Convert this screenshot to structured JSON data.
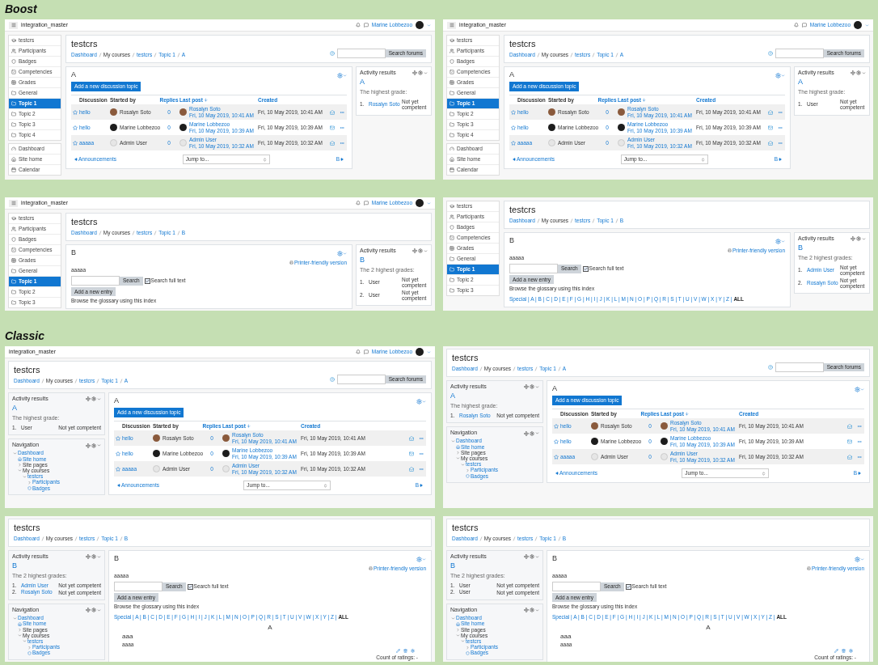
{
  "sections": [
    {
      "label": "Boost",
      "panels": [
        {
          "kind": "boost",
          "navbar": {
            "menu_button": true,
            "site": "integration_master",
            "user": "Marine Lobbezoo"
          },
          "sidebar": {
            "groups": [
              {
                "items": [
                  {
                    "kind": "course",
                    "label": "testcrs",
                    "selected": false
                  },
                  {
                    "kind": "people",
                    "label": "Participants",
                    "selected": false
                  },
                  {
                    "kind": "badges",
                    "label": "Badges",
                    "selected": false
                  },
                  {
                    "kind": "competencies",
                    "label": "Competencies",
                    "selected": false
                  },
                  {
                    "kind": "grades",
                    "label": "Grades",
                    "selected": false
                  },
                  {
                    "kind": "section",
                    "label": "General",
                    "selected": false
                  },
                  {
                    "kind": "section",
                    "label": "Topic 1",
                    "selected": true
                  },
                  {
                    "kind": "section",
                    "label": "Topic 2",
                    "selected": false
                  },
                  {
                    "kind": "section",
                    "label": "Topic 3",
                    "selected": false
                  },
                  {
                    "kind": "section",
                    "label": "Topic 4",
                    "selected": false
                  }
                ]
              },
              {
                "items": [
                  {
                    "kind": "dashboard",
                    "label": "Dashboard",
                    "selected": false
                  },
                  {
                    "kind": "home",
                    "label": "Site home",
                    "selected": false
                  },
                  {
                    "kind": "calendar",
                    "label": "Calendar",
                    "selected": false
                  }
                ]
              }
            ]
          },
          "header": {
            "title": "testcrs",
            "breadcrumbs": [
              {
                "text": "Dashboard",
                "link": true
              },
              {
                "text": "My courses",
                "link": false
              },
              {
                "text": "testcrs",
                "link": true
              },
              {
                "text": "Topic 1",
                "link": true
              },
              {
                "text": "A",
                "link": true
              }
            ],
            "search_button": "Search forums"
          },
          "main": {
            "kind": "forum",
            "heading": "A",
            "button": "Add a new discussion topic",
            "columns": [
              {
                "text": "Discussion",
                "link": false
              },
              {
                "text": "Started by",
                "link": false
              },
              {
                "text": "Replies",
                "link": true
              },
              {
                "text": "Last post",
                "link": true
              },
              {
                "text": "Created",
                "link": true
              }
            ],
            "rows": [
              {
                "starred": false,
                "subject": "hello",
                "avatar": {
                  "kind": "photo_light"
                },
                "author": "Rosalyn Soto",
                "replies": "0",
                "last_avatar": {
                  "kind": "photo_light"
                },
                "last_author": "Rosalyn Soto",
                "last_date": "Fri, 10 May 2019, 10:41 AM",
                "created": "Fri, 10 May 2019, 10:41 AM",
                "subscribed": false
              },
              {
                "starred": false,
                "subject": "hello",
                "avatar": {
                  "kind": "photo_dark"
                },
                "author": "Marine Lobbezoo",
                "replies": "0",
                "last_avatar": {
                  "kind": "photo_dark"
                },
                "last_author": "Marine Lobbezoo",
                "last_date": "Fri, 10 May 2019, 10:39 AM",
                "created": "Fri, 10 May 2019, 10:39 AM",
                "subscribed": true
              },
              {
                "starred": false,
                "subject": "aaaaa",
                "avatar": {
                  "kind": "default"
                },
                "author": "Admin User",
                "replies": "0",
                "last_avatar": {
                  "kind": "default"
                },
                "last_author": "Admin User",
                "last_date": "Fri, 10 May 2019, 10:32 AM",
                "created": "Fri, 10 May 2019, 10:32 AM",
                "subscribed": false
              }
            ],
            "prev": "Announcements",
            "jump": "Jump to...",
            "next": "B"
          },
          "activity_results": {
            "title": "Activity results",
            "activity": "A",
            "heading": "The highest grade:",
            "grades": [
              {
                "rank": "1.",
                "name": "Rosalyn Soto",
                "link": true,
                "result": "Not yet competent"
              }
            ]
          }
        },
        {
          "kind": "boost",
          "navbar": {
            "menu_button": true,
            "site": "integration_master",
            "user": "Marine Lobbezoo"
          },
          "sidebar": {
            "groups": [
              {
                "items": [
                  {
                    "kind": "course",
                    "label": "testcrs",
                    "selected": false
                  },
                  {
                    "kind": "people",
                    "label": "Participants",
                    "selected": false
                  },
                  {
                    "kind": "badges",
                    "label": "Badges",
                    "selected": false
                  },
                  {
                    "kind": "competencies",
                    "label": "Competencies",
                    "selected": false
                  },
                  {
                    "kind": "grades",
                    "label": "Grades",
                    "selected": false
                  },
                  {
                    "kind": "section",
                    "label": "General",
                    "selected": false
                  },
                  {
                    "kind": "section",
                    "label": "Topic 1",
                    "selected": true
                  },
                  {
                    "kind": "section",
                    "label": "Topic 2",
                    "selected": false
                  },
                  {
                    "kind": "section",
                    "label": "Topic 3",
                    "selected": false
                  },
                  {
                    "kind": "section",
                    "label": "Topic 4",
                    "selected": false
                  }
                ]
              },
              {
                "items": [
                  {
                    "kind": "dashboard",
                    "label": "Dashboard",
                    "selected": false
                  },
                  {
                    "kind": "home",
                    "label": "Site home",
                    "selected": false
                  },
                  {
                    "kind": "calendar",
                    "label": "Calendar",
                    "selected": false
                  }
                ]
              }
            ]
          },
          "header": {
            "title": "testcrs",
            "breadcrumbs": [
              {
                "text": "Dashboard",
                "link": true
              },
              {
                "text": "My courses",
                "link": false
              },
              {
                "text": "testcrs",
                "link": true
              },
              {
                "text": "Topic 1",
                "link": true
              },
              {
                "text": "A",
                "link": true
              }
            ],
            "search_button": "Search forums"
          },
          "main": {
            "kind": "forum",
            "heading": "A",
            "button": "Add a new discussion topic",
            "columns": [
              {
                "text": "Discussion",
                "link": false
              },
              {
                "text": "Started by",
                "link": false
              },
              {
                "text": "Replies",
                "link": true
              },
              {
                "text": "Last post",
                "link": true
              },
              {
                "text": "Created",
                "link": true
              }
            ],
            "rows": [
              {
                "starred": false,
                "subject": "hello",
                "avatar": {
                  "kind": "photo_light"
                },
                "author": "Rosalyn Soto",
                "replies": "0",
                "last_avatar": {
                  "kind": "photo_light"
                },
                "last_author": "Rosalyn Soto",
                "last_date": "Fri, 10 May 2019, 10:41 AM",
                "created": "Fri, 10 May 2019, 10:41 AM",
                "subscribed": false
              },
              {
                "starred": false,
                "subject": "hello",
                "avatar": {
                  "kind": "photo_dark"
                },
                "author": "Marine Lobbezoo",
                "replies": "0",
                "last_avatar": {
                  "kind": "photo_dark"
                },
                "last_author": "Marine Lobbezoo",
                "last_date": "Fri, 10 May 2019, 10:39 AM",
                "created": "Fri, 10 May 2019, 10:39 AM",
                "subscribed": true
              },
              {
                "starred": false,
                "subject": "aaaaa",
                "avatar": {
                  "kind": "default"
                },
                "author": "Admin User",
                "replies": "0",
                "last_avatar": {
                  "kind": "default"
                },
                "last_author": "Admin User",
                "last_date": "Fri, 10 May 2019, 10:32 AM",
                "created": "Fri, 10 May 2019, 10:32 AM",
                "subscribed": false
              }
            ],
            "prev": "Announcements",
            "jump": "Jump to...",
            "next": "B"
          },
          "activity_results": {
            "title": "Activity results",
            "activity": "A",
            "heading": "The highest grade:",
            "grades": [
              {
                "rank": "1.",
                "name": "User",
                "link": false,
                "result": "Not yet competent"
              }
            ]
          }
        },
        {
          "kind": "boost",
          "navbar": {
            "menu_button": true,
            "site": "integration_master",
            "user": "Marine Lobbezoo"
          },
          "sidebar": {
            "groups": [
              {
                "items": [
                  {
                    "kind": "course",
                    "label": "testcrs",
                    "selected": false
                  },
                  {
                    "kind": "people",
                    "label": "Participants",
                    "selected": false
                  },
                  {
                    "kind": "badges",
                    "label": "Badges",
                    "selected": false
                  },
                  {
                    "kind": "competencies",
                    "label": "Competencies",
                    "selected": false
                  },
                  {
                    "kind": "grades",
                    "label": "Grades",
                    "selected": false
                  },
                  {
                    "kind": "section",
                    "label": "General",
                    "selected": false
                  },
                  {
                    "kind": "section",
                    "label": "Topic 1",
                    "selected": true
                  },
                  {
                    "kind": "section",
                    "label": "Topic 2",
                    "selected": false
                  },
                  {
                    "kind": "section",
                    "label": "Topic 3",
                    "selected": false
                  }
                ]
              }
            ]
          },
          "header": {
            "title": "testcrs",
            "breadcrumbs": [
              {
                "text": "Dashboard",
                "link": true
              },
              {
                "text": "My courses",
                "link": false
              },
              {
                "text": "testcrs",
                "link": true
              },
              {
                "text": "Topic 1",
                "link": true
              },
              {
                "text": "B",
                "link": true
              }
            ]
          },
          "main": {
            "kind": "glossary",
            "heading": "B",
            "printer": "Printer-friendly version",
            "description": "aaaaa",
            "search_button": "Search",
            "full_text": {
              "label": "Search full text",
              "checked": true
            },
            "add_button": "Add a new entry",
            "browse": "Browse the glossary using this index"
          },
          "activity_results": {
            "title": "Activity results",
            "activity": "B",
            "heading": "The 2 highest grades:",
            "grades": [
              {
                "rank": "1.",
                "name": "User",
                "link": false,
                "result": "Not yet competent"
              },
              {
                "rank": "2.",
                "name": "User",
                "link": false,
                "result": "Not yet competent"
              }
            ]
          }
        },
        {
          "kind": "boost",
          "sidebar": {
            "groups": [
              {
                "items": [
                  {
                    "kind": "course",
                    "label": "testcrs",
                    "selected": false
                  },
                  {
                    "kind": "people",
                    "label": "Participants",
                    "selected": false
                  },
                  {
                    "kind": "badges",
                    "label": "Badges",
                    "selected": false
                  },
                  {
                    "kind": "competencies",
                    "label": "Competencies",
                    "selected": false
                  },
                  {
                    "kind": "grades",
                    "label": "Grades",
                    "selected": false
                  },
                  {
                    "kind": "section",
                    "label": "General",
                    "selected": false
                  },
                  {
                    "kind": "section",
                    "label": "Topic 1",
                    "selected": true
                  },
                  {
                    "kind": "section",
                    "label": "Topic 2",
                    "selected": false
                  },
                  {
                    "kind": "section",
                    "label": "Topic 3",
                    "selected": false
                  }
                ]
              }
            ]
          },
          "header": {
            "title": "testcrs",
            "breadcrumbs": [
              {
                "text": "Dashboard",
                "link": true
              },
              {
                "text": "My courses",
                "link": false
              },
              {
                "text": "testcrs",
                "link": true
              },
              {
                "text": "Topic 1",
                "link": true
              },
              {
                "text": "B",
                "link": true
              }
            ]
          },
          "main": {
            "kind": "glossary",
            "heading": "B",
            "printer": "Printer-friendly version",
            "description": "aaaaa",
            "search_button": "Search",
            "full_text": {
              "label": "Search full text",
              "checked": true
            },
            "add_button": "Add a new entry",
            "browse": "Browse the glossary using this index",
            "letters": "Special | A | B | C | D | E | F | G | H | I | J | K | L | M | N | O | P | Q | R | S | T | U | V | W | X | Y | Z | **ALL**"
          },
          "activity_results": {
            "title": "Activity results",
            "activity": "B",
            "heading": "The 2 highest grades:",
            "grades": [
              {
                "rank": "1.",
                "name": "Admin User",
                "link": true,
                "result": "Not yet competent"
              },
              {
                "rank": "2.",
                "name": "Rosalyn Soto",
                "link": true,
                "result": "Not yet competent"
              }
            ]
          }
        }
      ]
    },
    {
      "label": "Classic",
      "panels": [
        {
          "kind": "classic",
          "navbar": {
            "menu_button": false,
            "site": "integration_master",
            "user": "Marine Lobbezoo"
          },
          "header": {
            "title": "testcrs",
            "breadcrumbs": [
              {
                "text": "Dashboard",
                "link": true
              },
              {
                "text": "My courses",
                "link": false
              },
              {
                "text": "testcrs",
                "link": true
              },
              {
                "text": "Topic 1",
                "link": true
              },
              {
                "text": "A",
                "link": true
              }
            ],
            "search_button": "Search forums"
          },
          "activity_results": {
            "title": "Activity results",
            "activity": "A",
            "heading": "The highest grade:",
            "grades": [
              {
                "rank": "1.",
                "name": "User",
                "link": false,
                "result": "Not yet competent"
              }
            ]
          },
          "navigation": {
            "title": "Navigation",
            "tree": [
              {
                "kind": "branch",
                "label": "Dashboard",
                "link": true,
                "expanded": true,
                "children": [
                  {
                    "kind": "home",
                    "label": "Site home",
                    "link": true
                  },
                  {
                    "kind": "branch",
                    "label": "Site pages",
                    "link": false,
                    "expanded": false
                  },
                  {
                    "kind": "branch",
                    "label": "My courses",
                    "link": false,
                    "expanded": true,
                    "children": [
                      {
                        "kind": "branch",
                        "label": "testcrs",
                        "link": true,
                        "expanded": true,
                        "children": [
                          {
                            "kind": "branch",
                            "label": "Participants",
                            "link": true,
                            "expanded": false
                          },
                          {
                            "kind": "badges",
                            "label": "Badges",
                            "link": true
                          }
                        ]
                      }
                    ]
                  }
                ]
              }
            ]
          },
          "main": {
            "kind": "forum",
            "heading": "A",
            "button": "Add a new discussion topic",
            "columns": [
              {
                "text": "Discussion",
                "link": false
              },
              {
                "text": "Started by",
                "link": false
              },
              {
                "text": "Replies",
                "link": true
              },
              {
                "text": "Last post",
                "link": true
              },
              {
                "text": "Created",
                "link": true
              }
            ],
            "rows": [
              {
                "starred": false,
                "subject": "hello",
                "avatar": {
                  "kind": "photo_light"
                },
                "author": "Rosalyn Soto",
                "replies": "0",
                "last_avatar": {
                  "kind": "photo_light"
                },
                "last_author": "Rosalyn Soto",
                "last_date": "Fri, 10 May 2019, 10:41 AM",
                "created": "Fri, 10 May 2019, 10:41 AM",
                "subscribed": false
              },
              {
                "starred": false,
                "subject": "hello",
                "avatar": {
                  "kind": "photo_dark"
                },
                "author": "Marine Lobbezoo",
                "replies": "0",
                "last_avatar": {
                  "kind": "photo_dark"
                },
                "last_author": "Marine Lobbezoo",
                "last_date": "Fri, 10 May 2019, 10:39 AM",
                "created": "Fri, 10 May 2019, 10:39 AM",
                "subscribed": true
              },
              {
                "starred": false,
                "subject": "aaaaa",
                "avatar": {
                  "kind": "default"
                },
                "author": "Admin User",
                "replies": "0",
                "last_avatar": {
                  "kind": "default"
                },
                "last_author": "Admin User",
                "last_date": "Fri, 10 May 2019, 10:32 AM",
                "created": "Fri, 10 May 2019, 10:32 AM",
                "subscribed": false
              }
            ],
            "prev": "Announcements",
            "jump": "Jump to...",
            "next": "B"
          }
        },
        {
          "kind": "classic",
          "header": {
            "title": "testcrs",
            "breadcrumbs": [
              {
                "text": "Dashboard",
                "link": true
              },
              {
                "text": "My courses",
                "link": false
              },
              {
                "text": "testcrs",
                "link": true
              },
              {
                "text": "Topic 1",
                "link": true
              },
              {
                "text": "A",
                "link": true
              }
            ],
            "search_button": "Search forums"
          },
          "activity_results": {
            "title": "Activity results",
            "activity": "A",
            "heading": "The highest grade:",
            "grades": [
              {
                "rank": "1.",
                "name": "Rosalyn Soto",
                "link": true,
                "result": "Not yet competent"
              }
            ]
          },
          "navigation": {
            "title": "Navigation",
            "tree": [
              {
                "kind": "branch",
                "label": "Dashboard",
                "link": true,
                "expanded": true,
                "children": [
                  {
                    "kind": "home",
                    "label": "Site home",
                    "link": true
                  },
                  {
                    "kind": "branch",
                    "label": "Site pages",
                    "link": false,
                    "expanded": false
                  },
                  {
                    "kind": "branch",
                    "label": "My courses",
                    "link": false,
                    "expanded": true,
                    "children": [
                      {
                        "kind": "branch",
                        "label": "testcrs",
                        "link": true,
                        "expanded": true,
                        "children": [
                          {
                            "kind": "branch",
                            "label": "Participants",
                            "link": true,
                            "expanded": false
                          },
                          {
                            "kind": "badges",
                            "label": "Badges",
                            "link": true
                          }
                        ]
                      }
                    ]
                  }
                ]
              }
            ]
          },
          "main": {
            "kind": "forum",
            "heading": "A",
            "button": "Add a new discussion topic",
            "columns": [
              {
                "text": "Discussion",
                "link": false
              },
              {
                "text": "Started by",
                "link": false
              },
              {
                "text": "Replies",
                "link": true
              },
              {
                "text": "Last post",
                "link": true
              },
              {
                "text": "Created",
                "link": true
              }
            ],
            "rows": [
              {
                "starred": false,
                "subject": "hello",
                "avatar": {
                  "kind": "photo_light"
                },
                "author": "Rosalyn Soto",
                "replies": "0",
                "last_avatar": {
                  "kind": "photo_light"
                },
                "last_author": "Rosalyn Soto",
                "last_date": "Fri, 10 May 2019, 10:41 AM",
                "created": "Fri, 10 May 2019, 10:41 AM",
                "subscribed": false
              },
              {
                "starred": false,
                "subject": "hello",
                "avatar": {
                  "kind": "photo_dark"
                },
                "author": "Marine Lobbezoo",
                "replies": "0",
                "last_avatar": {
                  "kind": "photo_dark"
                },
                "last_author": "Marine Lobbezoo",
                "last_date": "Fri, 10 May 2019, 10:39 AM",
                "created": "Fri, 10 May 2019, 10:39 AM",
                "subscribed": true
              },
              {
                "starred": false,
                "subject": "aaaaa",
                "avatar": {
                  "kind": "default"
                },
                "author": "Admin User",
                "replies": "0",
                "last_avatar": {
                  "kind": "default"
                },
                "last_author": "Admin User",
                "last_date": "Fri, 10 May 2019, 10:32 AM",
                "created": "Fri, 10 May 2019, 10:32 AM",
                "subscribed": false
              }
            ],
            "prev": "Announcements",
            "jump": "Jump to...",
            "next": "B"
          }
        },
        {
          "kind": "classic",
          "header": {
            "title": "testcrs",
            "breadcrumbs": [
              {
                "text": "Dashboard",
                "link": true
              },
              {
                "text": "My courses",
                "link": false
              },
              {
                "text": "testcrs",
                "link": true
              },
              {
                "text": "Topic 1",
                "link": true
              },
              {
                "text": "B",
                "link": true
              }
            ]
          },
          "activity_results": {
            "title": "Activity results",
            "activity": "B",
            "heading": "The 2 highest grades:",
            "grades": [
              {
                "rank": "1.",
                "name": "Admin User",
                "link": true,
                "result": "Not yet competent"
              },
              {
                "rank": "2.",
                "name": "Rosalyn Soto",
                "link": true,
                "result": "Not yet competent"
              }
            ]
          },
          "navigation": {
            "title": "Navigation",
            "tree": [
              {
                "kind": "branch",
                "label": "Dashboard",
                "link": true,
                "expanded": true,
                "children": [
                  {
                    "kind": "home",
                    "label": "Site home",
                    "link": true
                  },
                  {
                    "kind": "branch",
                    "label": "Site pages",
                    "link": false,
                    "expanded": false
                  },
                  {
                    "kind": "branch",
                    "label": "My courses",
                    "link": false,
                    "expanded": true,
                    "children": [
                      {
                        "kind": "branch",
                        "label": "testcrs",
                        "link": true,
                        "expanded": true,
                        "children": [
                          {
                            "kind": "branch",
                            "label": "Participants",
                            "link": true,
                            "expanded": false
                          },
                          {
                            "kind": "badges",
                            "label": "Badges",
                            "link": true
                          }
                        ]
                      }
                    ]
                  }
                ]
              }
            ]
          },
          "main": {
            "kind": "glossary",
            "heading": "B",
            "printer": "Printer-friendly version",
            "description": "aaaaa",
            "search_button": "Search",
            "full_text": {
              "label": "Search full text",
              "checked": true
            },
            "add_button": "Add a new entry",
            "browse": "Browse the glossary using this index",
            "letters": "Special | A | B | C | D | E | F | G | H | I | J | K | L | M | N | O | P | Q | R | S | T | U | V | W | X | Y | Z | **ALL**",
            "entries": [
              {
                "letter": "A",
                "concept": "aaa",
                "definition": "aaaa",
                "ratings": "Count of ratings: -"
              }
            ]
          }
        },
        {
          "kind": "classic",
          "header": {
            "title": "testcrs",
            "breadcrumbs": [
              {
                "text": "Dashboard",
                "link": true
              },
              {
                "text": "My courses",
                "link": false
              },
              {
                "text": "testcrs",
                "link": true
              },
              {
                "text": "Topic 1",
                "link": true
              },
              {
                "text": "B",
                "link": true
              }
            ]
          },
          "activity_results": {
            "title": "Activity results",
            "activity": "B",
            "heading": "The 2 highest grades:",
            "grades": [
              {
                "rank": "1.",
                "name": "User",
                "link": false,
                "result": "Not yet competent"
              },
              {
                "rank": "2.",
                "name": "User",
                "link": false,
                "result": "Not yet competent"
              }
            ]
          },
          "navigation": {
            "title": "Navigation",
            "tree": [
              {
                "kind": "branch",
                "label": "Dashboard",
                "link": true,
                "expanded": true,
                "children": [
                  {
                    "kind": "home",
                    "label": "Site home",
                    "link": true
                  },
                  {
                    "kind": "branch",
                    "label": "Site pages",
                    "link": false,
                    "expanded": false
                  },
                  {
                    "kind": "branch",
                    "label": "My courses",
                    "link": false,
                    "expanded": true,
                    "children": [
                      {
                        "kind": "branch",
                        "label": "testcrs",
                        "link": true,
                        "expanded": true,
                        "children": [
                          {
                            "kind": "branch",
                            "label": "Participants",
                            "link": true,
                            "expanded": false
                          },
                          {
                            "kind": "badges",
                            "label": "Badges",
                            "link": true
                          }
                        ]
                      }
                    ]
                  }
                ]
              }
            ]
          },
          "main": {
            "kind": "glossary",
            "heading": "B",
            "printer": "Printer-friendly version",
            "description": "aaaaa",
            "search_button": "Search",
            "full_text": {
              "label": "Search full text",
              "checked": true
            },
            "add_button": "Add a new entry",
            "browse": "Browse the glossary using this index",
            "letters": "Special | A | B | C | D | E | F | G | H | I | J | K | L | M | N | O | P | Q | R | S | T | U | V | W | X | Y | Z | **ALL**",
            "entries": [
              {
                "letter": "A",
                "concept": "aaa",
                "definition": "aaaa",
                "ratings": "Count of ratings: -"
              }
            ]
          }
        }
      ]
    }
  ]
}
